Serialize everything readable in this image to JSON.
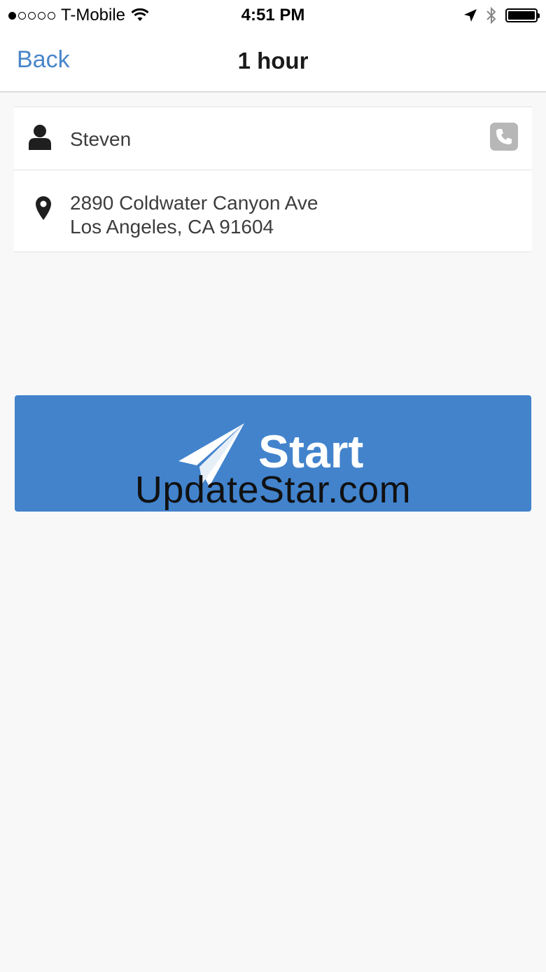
{
  "status_bar": {
    "carrier": "T-Mobile",
    "signal_strength": 1,
    "time": "4:51 PM",
    "icons": [
      "wifi-icon",
      "location-arrow-icon",
      "bluetooth-icon",
      "battery-icon"
    ],
    "battery_level": 1.0
  },
  "nav": {
    "back_label": "Back",
    "title": "1 hour"
  },
  "contact": {
    "name": "Steven",
    "icon": "person-icon",
    "action_icon": "phone-icon"
  },
  "address": {
    "icon": "map-pin-icon",
    "line1": "2890 Coldwater Canyon Ave",
    "line2": "Los Angeles, CA 91604"
  },
  "start_button": {
    "label": "Start",
    "icon": "paper-plane-icon",
    "watermark": "UpdateStar.com"
  },
  "colors": {
    "accent": "#4a86c8",
    "button": "#4283cc",
    "background": "#f8f8f8"
  }
}
